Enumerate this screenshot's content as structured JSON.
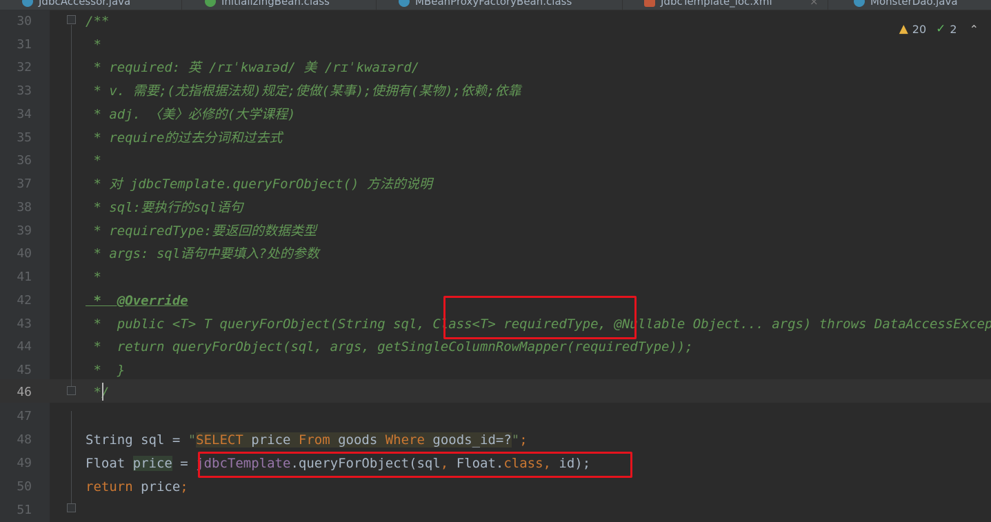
{
  "tabs": [
    {
      "label": "JdbcAccessor.java",
      "icon": "java-class-icon"
    },
    {
      "label": "InitializingBean.class",
      "icon": "interface-icon"
    },
    {
      "label": "MBeanProxyFactoryBean.class",
      "icon": "class-icon"
    },
    {
      "label": "JdbcTemplate_ioc.xml",
      "icon": "spring-xml-icon"
    },
    {
      "label": "MonsterDao.java",
      "icon": "java-class-icon"
    }
  ],
  "inspections": {
    "warnings": "20",
    "weak_warnings": "2"
  },
  "colors": {
    "comment": "#629755",
    "keyword": "#cc7832",
    "string": "#6a8759",
    "field": "#9876aa",
    "text": "#a9b7c6",
    "highlight_box": "#e5131d"
  },
  "lines": [
    {
      "n": "30",
      "t": "/**"
    },
    {
      "n": "31",
      "t": " *"
    },
    {
      "n": "32",
      "t": " * required: 英 /rɪˈkwaɪəd/ 美 /rɪˈkwaɪərd/"
    },
    {
      "n": "33",
      "t": " * v. 需要;(尤指根据法规)规定;使做(某事);使拥有(某物);依赖;依靠"
    },
    {
      "n": "34",
      "t": " * adj. 〈美〉必修的(大学课程)"
    },
    {
      "n": "35",
      "t": " * require的过去分词和过去式"
    },
    {
      "n": "36",
      "t": " *"
    },
    {
      "n": "37",
      "t": " * 对 jdbcTemplate.queryForObject() 方法的说明"
    },
    {
      "n": "38",
      "t": " * sql:要执行的sql语句"
    },
    {
      "n": "39",
      "t": " * requiredType:要返回的数据类型"
    },
    {
      "n": "40",
      "t": " * args: sql语句中要填入?处的参数"
    },
    {
      "n": "41",
      "t": " *"
    },
    {
      "n": "42",
      "t": " *  @Override"
    },
    {
      "n": "43",
      "t": " *  public <T> T queryForObject(String sql, Class<T> requiredType, @Nullable Object... args) throws DataAccessException {"
    },
    {
      "n": "44",
      "t": " *  return queryForObject(sql, args, getSingleColumnRowMapper(requiredType));"
    },
    {
      "n": "45",
      "t": " *  }"
    },
    {
      "n": "46",
      "t": " */"
    },
    {
      "n": "47",
      "t": ""
    },
    {
      "n": "48",
      "t": "String sql = \"SELECT price From goods Where goods_id=?\";"
    },
    {
      "n": "49",
      "t": "Float price = jdbcTemplate.queryForObject(sql, Float.class, id);"
    },
    {
      "n": "50",
      "t": "return price;"
    },
    {
      "n": "51",
      "t": ""
    }
  ],
  "code48": {
    "a": "String sql = ",
    "q1": "\"",
    "s1": "SELECT",
    "s2": " price ",
    "s3": "From",
    "s4": " goods ",
    "s5": "Where",
    "s6": " goods_id=?",
    "q2": "\"",
    "end": ";"
  },
  "code49": {
    "a": "Float ",
    "b": "price",
    "c": " = ",
    "d": "jdbcTemplate",
    "e": ".queryForObject(sql",
    "f": ", ",
    "g": "Float.",
    "h": "class",
    "i": ", ",
    "j": "id);"
  },
  "code50": {
    "a": "return",
    "b": " price",
    "c": ";"
  }
}
